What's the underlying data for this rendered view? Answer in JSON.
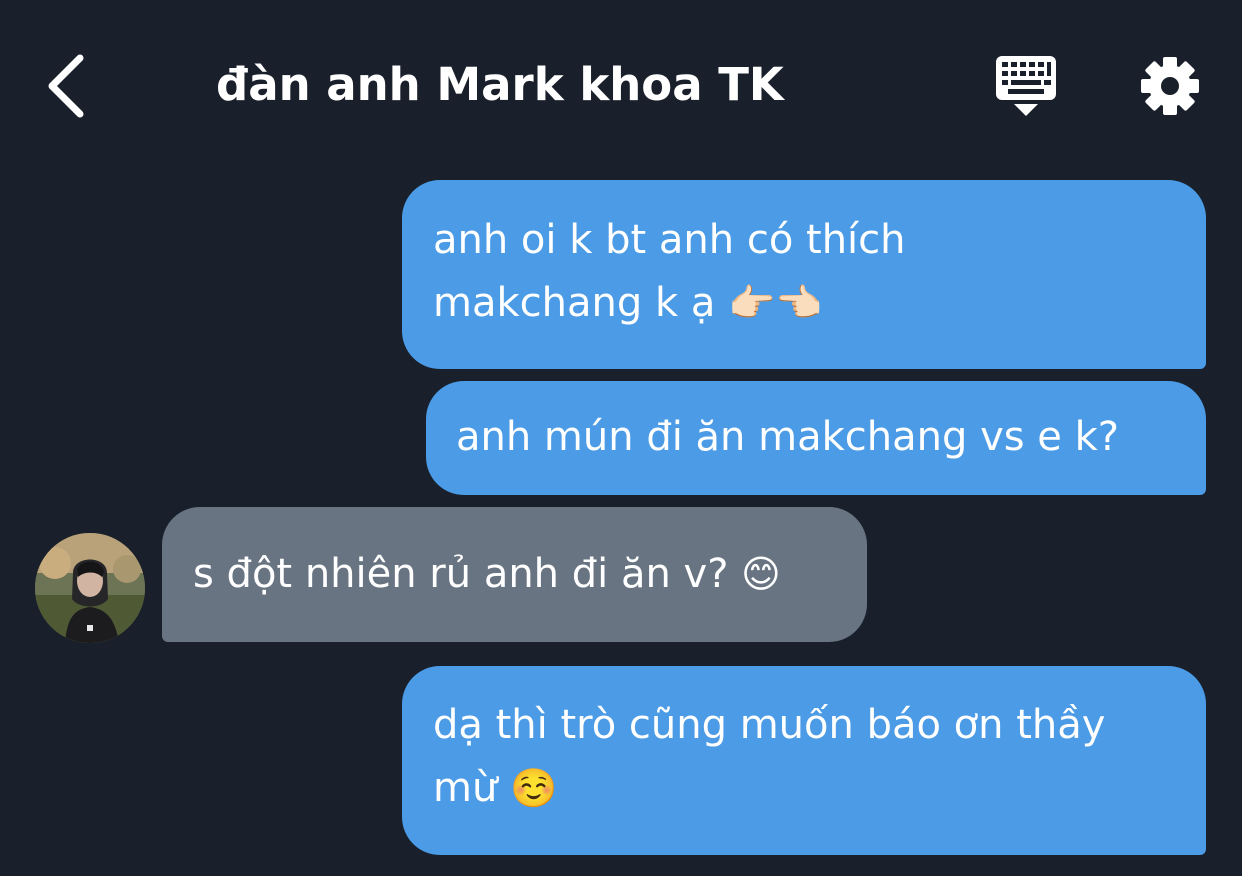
{
  "header": {
    "back_icon": "chevron-left-icon",
    "title": "đàn anh Mark khoa TK",
    "keyboard_icon": "keyboard-icon",
    "settings_icon": "gear-icon"
  },
  "messages": [
    {
      "direction": "sent",
      "lines": [
        "anh oi k bt anh có thích",
        "makchang k ạ"
      ],
      "emoji": "👉🏻👈🏻"
    },
    {
      "direction": "sent",
      "lines": [
        "anh mún đi ăn makchang vs e k?"
      ]
    },
    {
      "direction": "received",
      "lines": [
        "s đột nhiên rủ anh đi ăn v?"
      ],
      "emoji": "😊"
    },
    {
      "direction": "sent",
      "lines": [
        "dạ thì trò cũng muốn báo ơn thầy",
        "mừ"
      ],
      "emoji": "☺️"
    }
  ],
  "colors": {
    "background": "#1a202b",
    "sent_bubble": "#4b9be6",
    "received_bubble": "#687482",
    "text": "#ffffff"
  }
}
